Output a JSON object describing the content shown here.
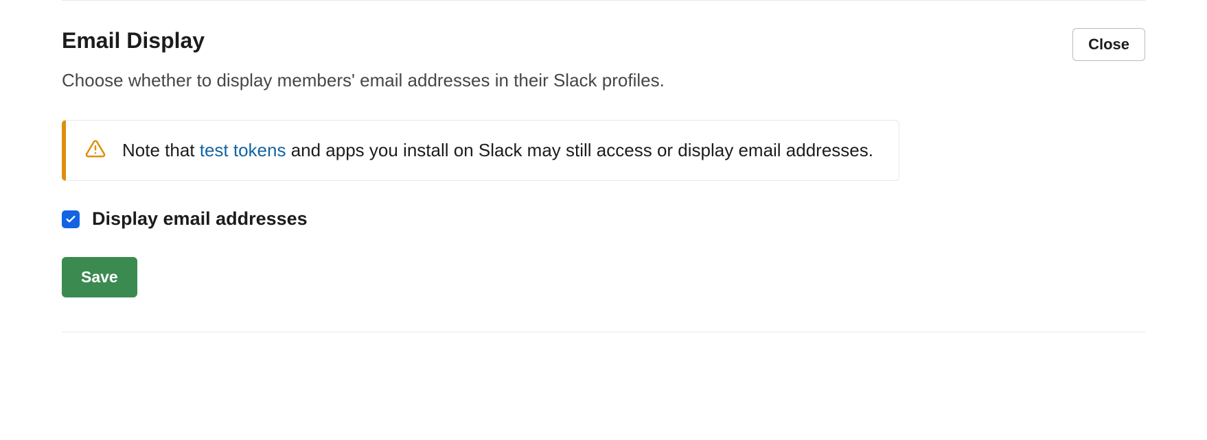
{
  "section": {
    "title": "Email Display",
    "description": "Choose whether to display members' email addresses in their Slack profiles.",
    "close_label": "Close"
  },
  "alert": {
    "text_before": "Note that ",
    "link_text": "test tokens",
    "text_after": " and apps you install on Slack may still access or display email addresses."
  },
  "checkbox": {
    "label": "Display email addresses",
    "checked": true
  },
  "actions": {
    "save_label": "Save"
  }
}
